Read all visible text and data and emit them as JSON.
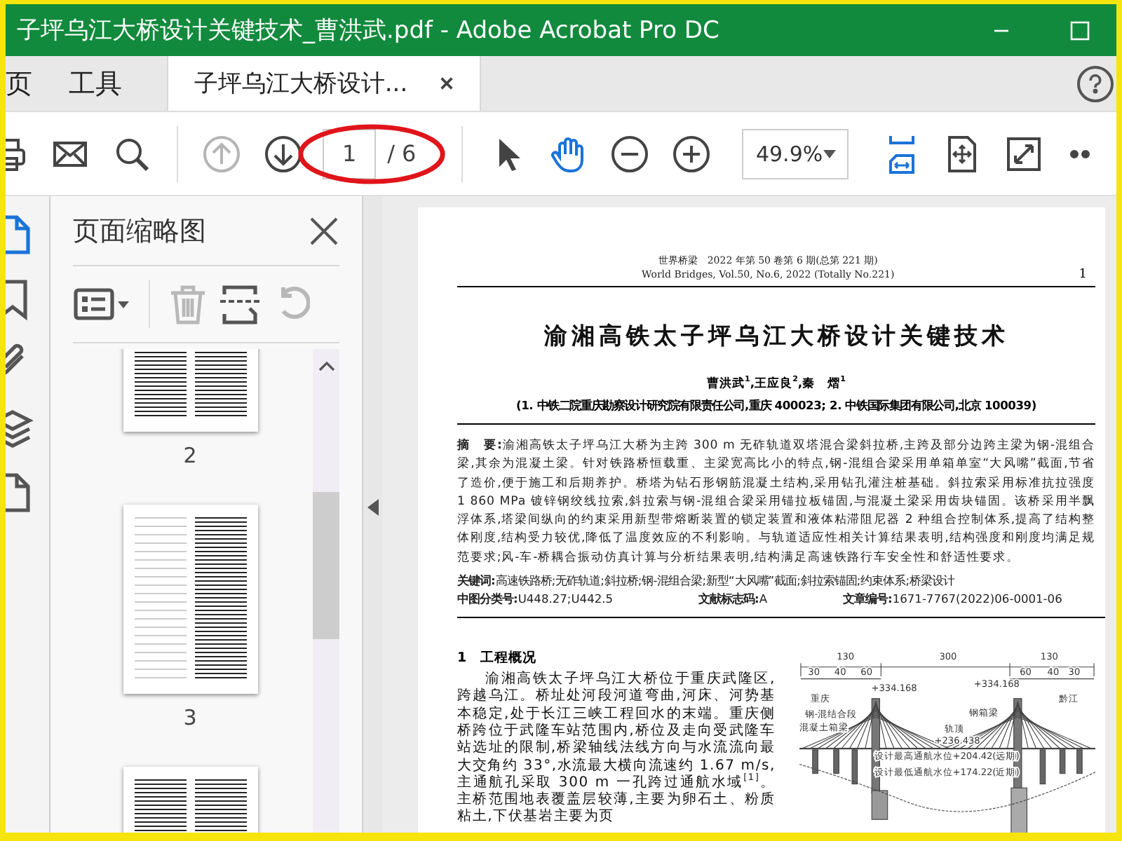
{
  "window": {
    "title": "子坪乌江大桥设计关键技术_曹洪武.pdf - Adobe Acrobat Pro DC"
  },
  "tabs": [
    {
      "label": "页",
      "selected": false,
      "closable": false
    },
    {
      "label": "工具",
      "selected": false,
      "closable": false
    },
    {
      "label": "子坪乌江大桥设计...",
      "selected": true,
      "closable": true
    }
  ],
  "toolbar": [
    {
      "kind": "print",
      "selected": false,
      "disabled": false
    },
    {
      "kind": "email",
      "selected": false,
      "disabled": false
    },
    {
      "kind": "search",
      "selected": false,
      "disabled": false
    },
    {
      "kind": "divider"
    },
    {
      "kind": "prev",
      "selected": false,
      "disabled": true
    },
    {
      "kind": "next",
      "selected": false,
      "disabled": false
    },
    {
      "kind": "page",
      "value": "1",
      "total": "/ 6",
      "highlighted": true
    },
    {
      "kind": "divider"
    },
    {
      "kind": "select",
      "selected": false,
      "disabled": false
    },
    {
      "kind": "hand",
      "selected": true,
      "disabled": false
    },
    {
      "kind": "zoom_out",
      "selected": false,
      "disabled": false
    },
    {
      "kind": "zoom_in",
      "selected": false,
      "disabled": false
    },
    {
      "kind": "zoom",
      "value": "49.9%"
    },
    {
      "kind": "fit_width",
      "selected": true,
      "disabled": false
    },
    {
      "kind": "fit_page",
      "selected": false,
      "disabled": false
    },
    {
      "kind": "fullscreen",
      "selected": false,
      "disabled": false
    },
    {
      "kind": "more",
      "selected": false,
      "disabled": false
    }
  ],
  "rail": [
    {
      "kind": "pages",
      "selected": true
    },
    {
      "kind": "bookmark",
      "selected": false
    },
    {
      "kind": "attachment",
      "selected": false
    },
    {
      "kind": "layers",
      "selected": false
    },
    {
      "kind": "document",
      "selected": false
    }
  ],
  "sidebar": {
    "title": "页面缩略图",
    "tools": [
      {
        "kind": "options",
        "disabled": false
      },
      {
        "kind": "delete",
        "disabled": true
      },
      {
        "kind": "extract",
        "disabled": false
      },
      {
        "kind": "rotate",
        "disabled": true
      }
    ],
    "thumbnails": [
      {
        "label": "2"
      },
      {
        "label": "3"
      }
    ],
    "more_below": true
  },
  "document": {
    "journal_cn": "世界桥梁　2022 年第 50 卷第 6 期(总第 221 期)",
    "journal_en": "World Bridges, Vol.50, No.6, 2022 (Totally No.221)",
    "page_number": "1",
    "title": "渝湘高铁太子坪乌江大桥设计关键技术",
    "authors": "曹洪武$^{1}$,王应良$^{2}$,秦　熠$^{1}$",
    "affiliation": "(1. 中铁二院重庆勘察设计研究院有限责任公司,重庆 400023; 2. 中铁国际集团有限公司,北京 100039)",
    "abstract": "**摘　要:**渝湘高铁太子坪乌江大桥为主跨 300 m 无砟轨道双塔混合梁斜拉桥,主跨及部分边跨主梁为钢-混组合梁,其余为混凝土梁。针对铁路桥恒载重、主梁宽高比小的特点,钢-混组合梁采用单箱单室“大风嘴”截面,节省了造价,便于施工和后期养护。桥塔为钻石形钢筋混凝土结构,采用钻孔灌注桩基础。斜拉索采用标准抗拉强度 1 860 MPa 镀锌钢绞线拉索,斜拉索与钢-混组合梁采用锚拉板锚固,与混凝土梁采用齿块锚固。该桥采用半飘浮体系,塔梁间纵向的约束采用新型带熔断装置的锁定装置和液体粘滞阻尼器 2 种组合控制体系,提高了结构整体刚度,结构受力较优,降低了温度效应的不利影响。与轨道适应性相关计算结果表明,结构强度和刚度均满足规范要求;风-车-桥耦合振动仿真计算与分析结果表明,结构满足高速铁路行车安全性和舒适性要求。",
    "keywords": "**关键词:**高速铁路桥;无砟轨道;斜拉桥;钢-混组合梁;新型“大风嘴”截面;斜拉索锚固;约束体系;桥梁设计",
    "classification": [
      "**中图分类号:**U448.27;U442.5",
      "**文献标志码:**A",
      "**文章编号:**1671-7767(2022)06-0001-06"
    ],
    "section_heading": "1　工程概况",
    "section_text": "渝湘高铁太子坪乌江大桥位于重庆武隆区,跨越乌江。桥址处河段河道弯曲,河床、河势基本稳定,处于长江三峡工程回水的末端。重庆侧桥跨位于武隆车站范围内,桥位及走向受武隆车站选址的限制,桥梁轴线法线方向与水流流向最大交角约 33°,水流最大横向流速约 1.67 m/s,主通航孔采取 300 m 一孔跨过通航水域$^{[1]}$。主桥范围地表覆盖层较薄,主要为卵石土、粉质粘土,下伏基岩主要为页",
    "figure_labels": [
      "130",
      "300",
      "130",
      "30",
      "40",
      "60",
      "60",
      "40",
      "30",
      "重庆",
      "黔江",
      "+334.168",
      "+334.168",
      "钢-混结合段",
      "混凝土箱梁",
      "钢箱梁",
      "轨顶",
      "+236.438",
      "设计最高通航水位+204.42(远期)",
      "设计最低通航水位+174.22(近期)"
    ]
  }
}
